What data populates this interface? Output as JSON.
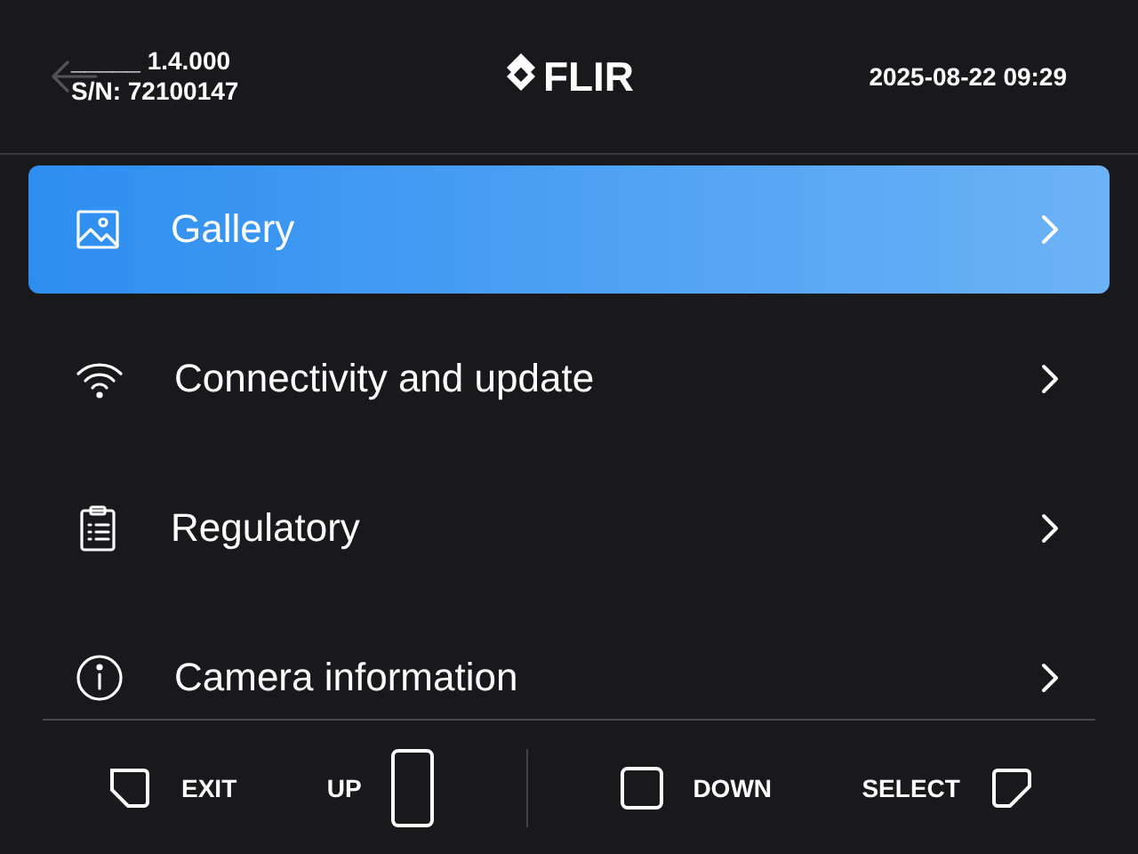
{
  "header": {
    "version": "_____ 1.4.000",
    "serial": "S/N: 72100147",
    "logo": "FLIR",
    "datetime": "2025-08-22 09:29"
  },
  "menu": [
    {
      "kind": "gallery",
      "label": "Gallery",
      "selected": true
    },
    {
      "kind": "wifi",
      "label": "Connectivity and update",
      "selected": false
    },
    {
      "kind": "clipboard",
      "label": "Regulatory",
      "selected": false
    },
    {
      "kind": "info",
      "label": "Camera information",
      "selected": false
    }
  ],
  "footer": [
    {
      "kind": "exit",
      "label": "EXIT"
    },
    {
      "kind": "up",
      "label": "UP"
    },
    {
      "kind": "down",
      "label": "DOWN"
    },
    {
      "kind": "select",
      "label": "SELECT"
    }
  ]
}
